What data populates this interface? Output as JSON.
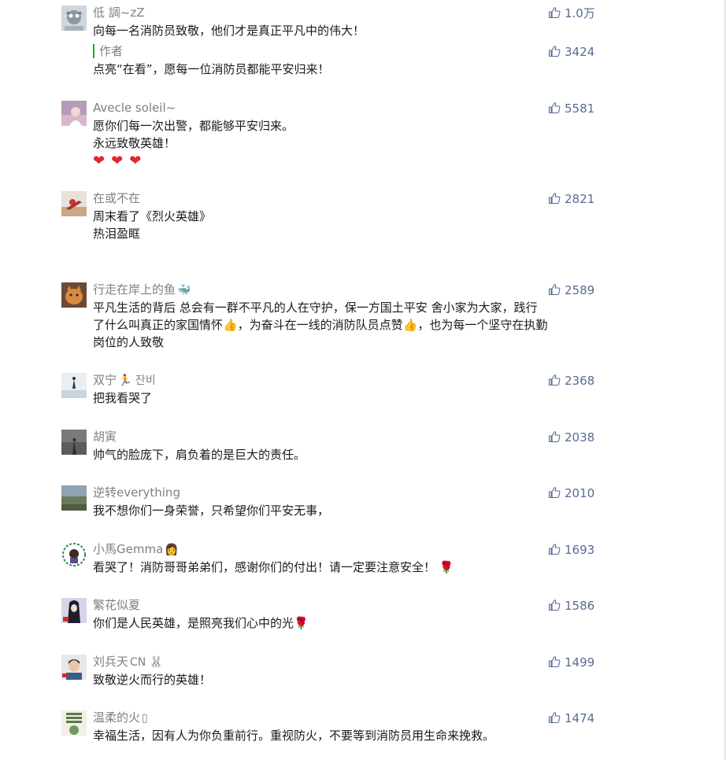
{
  "comments": [
    {
      "nickname": "低 調~zZ",
      "likes": "1.0万",
      "lines": [
        "向每一名消防员致敬，他们才是真正平凡中的伟大！"
      ],
      "reply": {
        "author_label": "作者",
        "likes": "3424",
        "text": "点亮“在看”，愿每一位消防员都能平安归来！"
      }
    },
    {
      "nickname": "Avecle soleil~",
      "likes": "5581",
      "lines": [
        "愿你们每一次出警，都能够平安归来。",
        "永远致敬英雄！"
      ],
      "hearts": [
        "❤",
        "❤",
        "❤"
      ]
    },
    {
      "nickname": "在或不在",
      "likes": "2821",
      "lines": [
        "周末看了《烈火英雄》",
        "热泪盈眶"
      ]
    },
    {
      "nickname": "行走在岸上的鱼",
      "nickname_emoji": "🐳",
      "likes": "2589",
      "lines": [
        "平凡生活的背后 总会有一群不平凡的人在守护，保一方国土平安 舍小家为大家，践行",
        "了什么叫真正的家国情怀👍，为奋斗在一线的消防队员点赞👍，也为每一个坚守在执勤",
        "岗位的人致敬"
      ]
    },
    {
      "nickname": "双宁",
      "nickname_emoji": "🏃 잔비",
      "likes": "2368",
      "lines": [
        "把我看哭了"
      ]
    },
    {
      "nickname": "胡寅",
      "likes": "2038",
      "lines": [
        "帅气的脸庞下，肩负着的是巨大的责任。"
      ]
    },
    {
      "nickname": "逆转everything",
      "likes": "2010",
      "lines": [
        "我不想你们一身荣誉，只希望你们平安无事，"
      ]
    },
    {
      "nickname": "小馬Gemma",
      "nickname_emoji": "👩",
      "likes": "1693",
      "lines": [
        "看哭了！消防哥哥弟弟们，感谢你们的付出！请一定要注意安全！ 🌹"
      ]
    },
    {
      "nickname": "繁花似夏",
      "likes": "1586",
      "lines": [
        "你们是人民英雄，是照亮我们心中的光🌹"
      ]
    },
    {
      "nickname": "刘兵天",
      "nickname_emoji": "CN 🐰",
      "likes": "1499",
      "lines": [
        "致敬逆火而行的英雄！"
      ]
    },
    {
      "nickname": "温柔的火",
      "nickname_emoji": "▯",
      "likes": "1474",
      "lines": [
        "幸福生活，因有人为你负重前行。重视防火，不要等到消防员用生命来挽救。"
      ]
    }
  ],
  "icons": {
    "like": "thumbs-up-icon",
    "heart": "heart-icon"
  },
  "colors": {
    "like_text": "#576b95",
    "nickname": "#7f7f7f",
    "author_bar": "#1aad19",
    "heart": "#e0282e"
  }
}
